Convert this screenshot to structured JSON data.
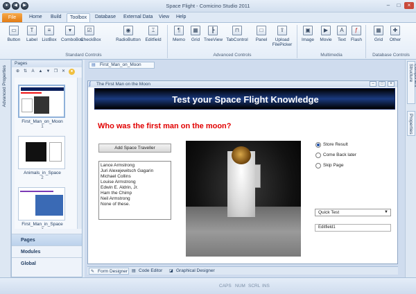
{
  "window": {
    "title": "Space Flight - Comicino Studio 2011"
  },
  "menu": {
    "file": "File",
    "tabs": [
      "Home",
      "Build",
      "Toolbox",
      "Database",
      "External Data",
      "View",
      "Help"
    ],
    "active": "Toolbox"
  },
  "ribbon": {
    "standard": [
      "Button",
      "Label",
      "ListBox",
      "ComboBox",
      "CheckBox",
      "RadioButton",
      "Editfield"
    ],
    "advanced": [
      "Memo",
      "Grid",
      "TreeView",
      "TabControl",
      "Panel",
      "Upload FilePicker"
    ],
    "multimedia": [
      "Image",
      "Movie",
      "Text",
      "Flash"
    ],
    "dbcontrols": [
      "Grid",
      "Other"
    ],
    "groups": {
      "standard": "Standard Controls",
      "advanced": "Advanced Controls",
      "multimedia": "Multimedia",
      "database": "Database Controls"
    }
  },
  "left_strip": {
    "label": "Advanced Properties"
  },
  "pages_panel": {
    "title": "Pages",
    "thumbs": [
      {
        "label": "First_Man_on_Moon",
        "num": "1"
      },
      {
        "label": "Animals_in_Space",
        "num": "2"
      },
      {
        "label": "First_Man_in_Space",
        "num": "3"
      }
    ],
    "nav": [
      "Pages",
      "Modules",
      "Global"
    ]
  },
  "right_strip": {
    "structure": "Component Structure",
    "properties": "Properties"
  },
  "doc": {
    "tab": "First_Man_on_Moon",
    "inner_title": "The First Man on the Moon",
    "banner": "Test your Space Flight Knowledge",
    "question": "Who was the first man on the moon?",
    "add_button": "Add Space Traveller",
    "list": [
      "Lance Armstrong",
      "Juri Alexejewitsch Gagarin",
      "Michael Collins",
      "Louise Armstrong",
      "Edwin E. Aldrin, Jr.",
      "Ham the Chimp",
      "Neil Armstrong",
      "None of these."
    ],
    "radios": [
      {
        "label": "Store Result",
        "checked": true
      },
      {
        "label": "Come Back later",
        "checked": false
      },
      {
        "label": "Skip Page",
        "checked": false
      }
    ],
    "combo": "Quick Test",
    "edit": "Editfield1",
    "bottom_tabs": [
      "Form Designer",
      "Code Editor",
      "Graphical Designer"
    ]
  },
  "status": [
    "CAPS",
    "NUM",
    "SCRL",
    "INS"
  ]
}
